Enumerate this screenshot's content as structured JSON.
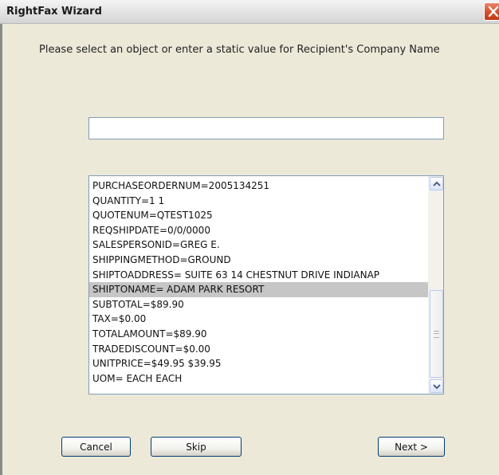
{
  "window": {
    "title": "RightFax Wizard"
  },
  "prompt": {
    "text": "Please select an object or enter a static value for Recipient's Company Name"
  },
  "static_value": {
    "value": "",
    "placeholder": ""
  },
  "object_list": {
    "selected_index": 7,
    "items": [
      "PURCHASEORDERNUM=2005134251",
      "QUANTITY=1  1",
      "QUOTENUM=QTEST1025",
      "REQSHIPDATE=0/0/0000",
      "SALESPERSONID=GREG E.",
      "SHIPPINGMETHOD=GROUND",
      "SHIPTOADDRESS=  SUITE 63  14 CHESTNUT DRIVE  INDIANAP",
      "SHIPTONAME= ADAM PARK RESORT",
      "SUBTOTAL=$89.90",
      "TAX=$0.00",
      "TOTALAMOUNT=$89.90",
      "TRADEDISCOUNT=$0.00",
      "UNITPRICE=$49.95  $39.95",
      "UOM= EACH      EACH"
    ]
  },
  "buttons": {
    "cancel": "Cancel",
    "skip": "Skip",
    "next": "Next >"
  },
  "icons": {
    "close": "close-icon",
    "scroll_up": "chevron-up-icon",
    "scroll_down": "chevron-down-icon"
  },
  "colors": {
    "close_button": "#d5532f",
    "selection": "#c6c6c6",
    "border": "#7f9db9"
  }
}
